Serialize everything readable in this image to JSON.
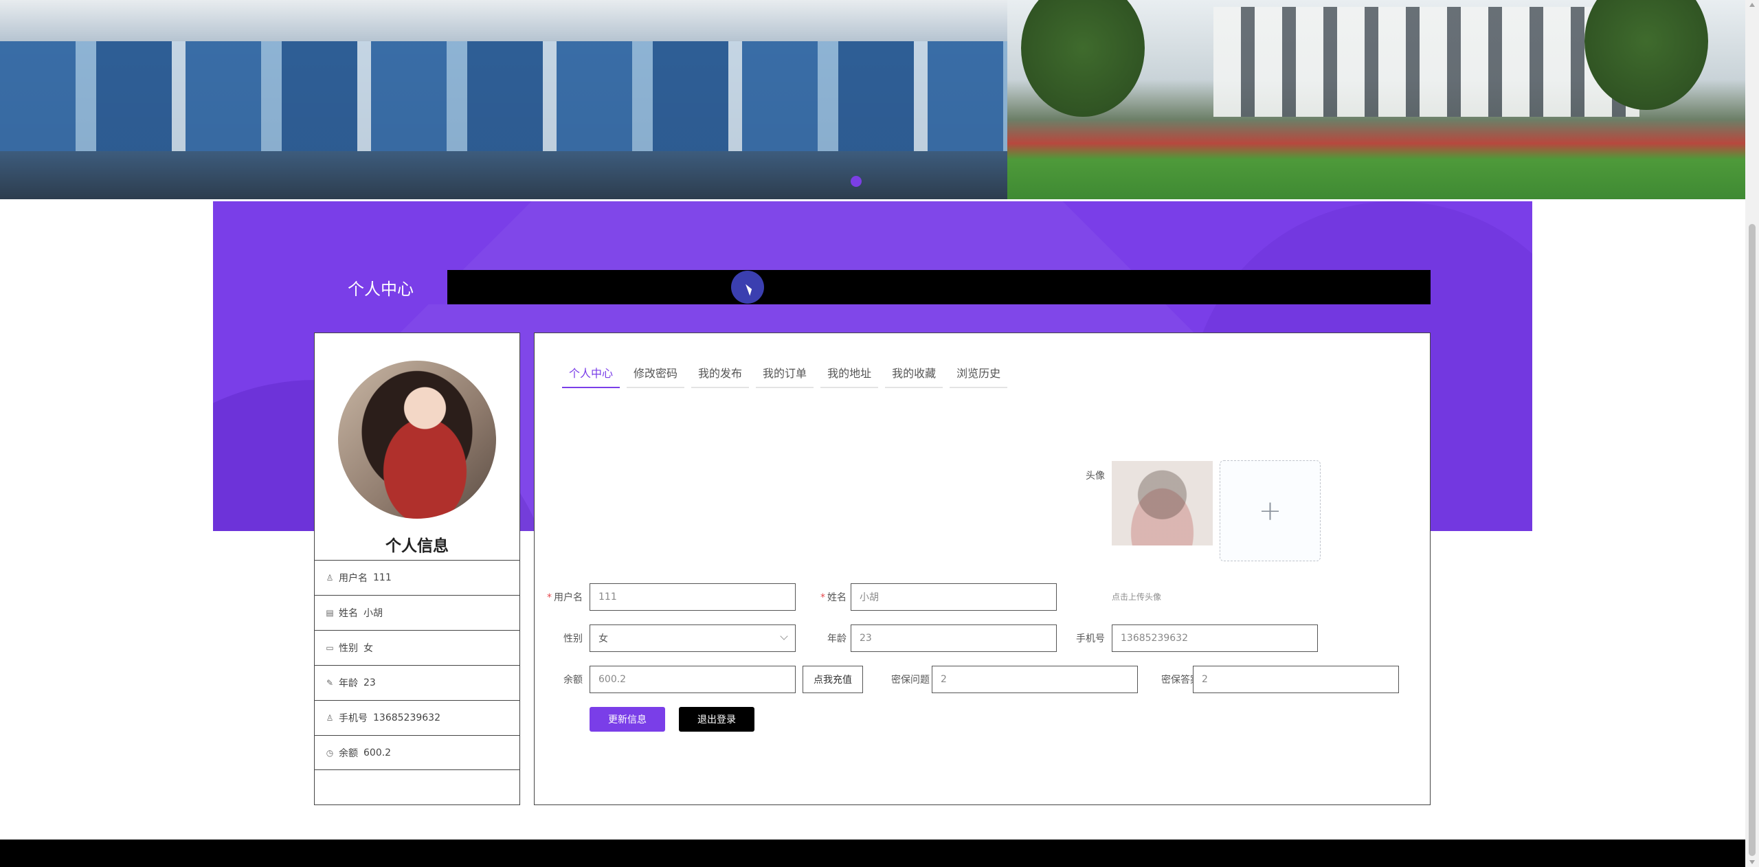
{
  "section": {
    "title": "个人中心"
  },
  "profile": {
    "heading": "个人信息",
    "rows": [
      {
        "icon": "user-icon",
        "label": "用户名",
        "value": "111"
      },
      {
        "icon": "id-card-icon",
        "label": "姓名",
        "value": "小胡"
      },
      {
        "icon": "chat-icon",
        "label": "性别",
        "value": "女"
      },
      {
        "icon": "edit-icon",
        "label": "年龄",
        "value": "23"
      },
      {
        "icon": "user-icon",
        "label": "手机号",
        "value": "13685239632"
      },
      {
        "icon": "clock-icon",
        "label": "余额",
        "value": "600.2"
      }
    ]
  },
  "tabs": [
    "个人中心",
    "修改密码",
    "我的发布",
    "我的订单",
    "我的地址",
    "我的收藏",
    "浏览历史"
  ],
  "form": {
    "avatar_label": "头像",
    "upload_plus": "+",
    "upload_hint": "点击上传头像",
    "username_label": "用户名",
    "username_value": "111",
    "name_label": "姓名",
    "name_value": "小胡",
    "gender_label": "性别",
    "gender_value": "女",
    "age_label": "年龄",
    "age_value": "23",
    "phone_label": "手机号",
    "phone_value": "13685239632",
    "balance_label": "余额",
    "balance_value": "600.2",
    "recharge_label": "点我充值",
    "question_label": "密保问题",
    "question_value": "2",
    "answer_label": "密保答案",
    "answer_value": "2",
    "update_label": "更新信息",
    "logout_label": "退出登录"
  },
  "colors": {
    "accent": "#7a3ee8",
    "dark": "#000000"
  }
}
